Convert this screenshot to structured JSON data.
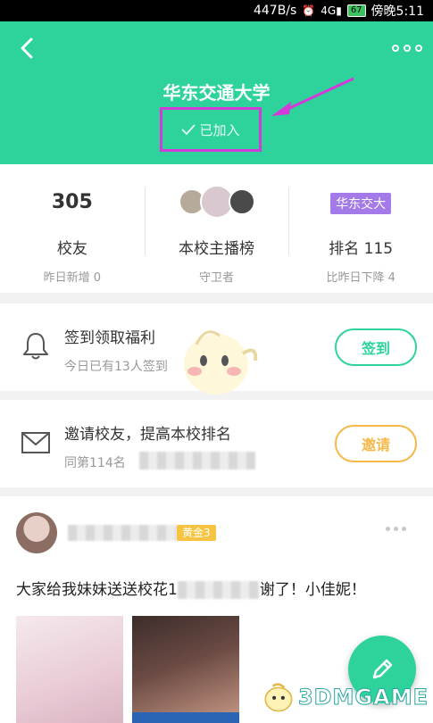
{
  "status_bar": {
    "network_speed": "447B/s",
    "signal": "4G",
    "battery": "67",
    "time": "傍晚5:11"
  },
  "header": {
    "title": "华东交通大学",
    "joined_label": "已加入",
    "accent_color": "#2ed39b",
    "highlight_color": "#d23bd7"
  },
  "stats": [
    {
      "number": "305",
      "label": "校友",
      "sub": "昨日新增 0"
    },
    {
      "label": "本校主播榜",
      "sub": "守卫者"
    },
    {
      "badge": "华东交大",
      "label": "排名 115",
      "sub": "比昨日下降 4"
    }
  ],
  "checkin": {
    "title": "签到领取福利",
    "sub": "今日已有13人签到",
    "button": "签到",
    "icon": "bell-icon"
  },
  "invite": {
    "title": "邀请校友，提高本校排名",
    "sub": "同第114名",
    "button": "邀请",
    "icon": "mail-icon"
  },
  "post": {
    "badge": "黄金3",
    "text_before": "大家给我妹妹送送校花1",
    "text_after": "谢了！小佳妮！"
  },
  "fab": {
    "icon": "pencil-icon"
  },
  "watermark": {
    "text": "3DMGAME"
  }
}
